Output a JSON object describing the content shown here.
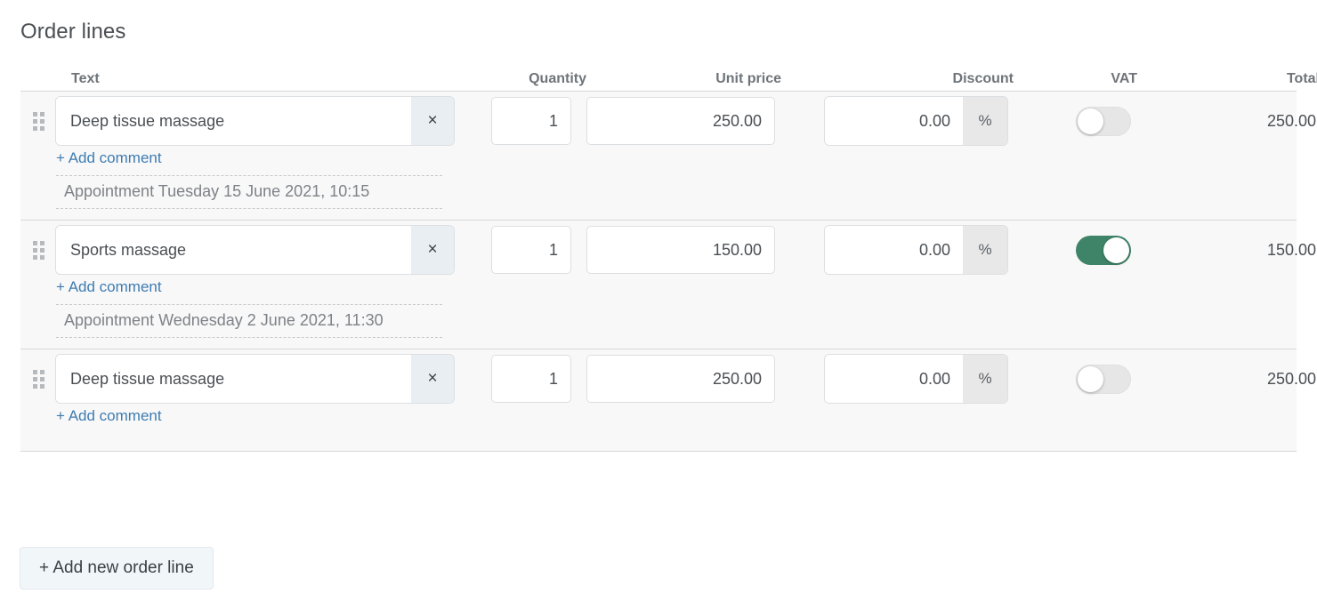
{
  "section": {
    "title": "Order lines"
  },
  "table": {
    "headers": {
      "text": "Text",
      "quantity": "Quantity",
      "unit_price": "Unit price",
      "discount": "Discount",
      "vat": "VAT",
      "total": "Total"
    },
    "clear_label": "×",
    "discount_suffix": "%",
    "add_comment_label": "+ Add comment",
    "rows": [
      {
        "text": "Deep tissue massage",
        "quantity": "1",
        "unit_price": "250.00",
        "discount": "0.00",
        "vat_on": false,
        "total": "250.00",
        "comment": "Appointment Tuesday 15 June 2021, 10:15"
      },
      {
        "text": "Sports massage",
        "quantity": "1",
        "unit_price": "150.00",
        "discount": "0.00",
        "vat_on": true,
        "total": "150.00",
        "comment": "Appointment Wednesday 2 June 2021, 11:30"
      },
      {
        "text": "Deep tissue massage",
        "quantity": "1",
        "unit_price": "250.00",
        "discount": "0.00",
        "vat_on": false,
        "total": "250.00",
        "comment": null
      }
    ]
  },
  "footer": {
    "add_line_label": "+ Add new order line"
  },
  "colors": {
    "toggle_on": "#3f8468",
    "link": "#3e7cb1",
    "row_bg": "#f8f8f8",
    "clear_btn_bg": "#e9eef2",
    "add_button_bg": "#f1f6f9"
  }
}
